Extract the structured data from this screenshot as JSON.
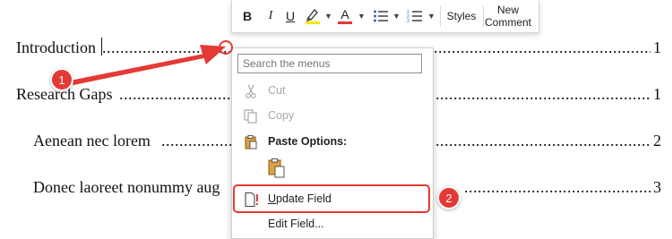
{
  "document": {
    "toc": [
      {
        "label": "Introduction",
        "page": "1"
      },
      {
        "label": "Research Gaps",
        "page": "1"
      },
      {
        "label": "Aenean nec lorem",
        "page": "2"
      },
      {
        "label": "Donec laoreet nonummy aug",
        "page": "3"
      }
    ]
  },
  "toolbar": {
    "bold": "B",
    "italic": "I",
    "underline": "U",
    "font_color_letter": "A",
    "styles": "Styles",
    "new_comment": "New Comment"
  },
  "menu": {
    "search_placeholder": "Search the menus",
    "cut": "Cut",
    "copy": "Copy",
    "paste_options": "Paste Options:",
    "update_field": "Update Field",
    "edit_field": "Edit Field..."
  },
  "annotations": {
    "step1": "1",
    "step2": "2",
    "accent_color": "#e53935"
  }
}
